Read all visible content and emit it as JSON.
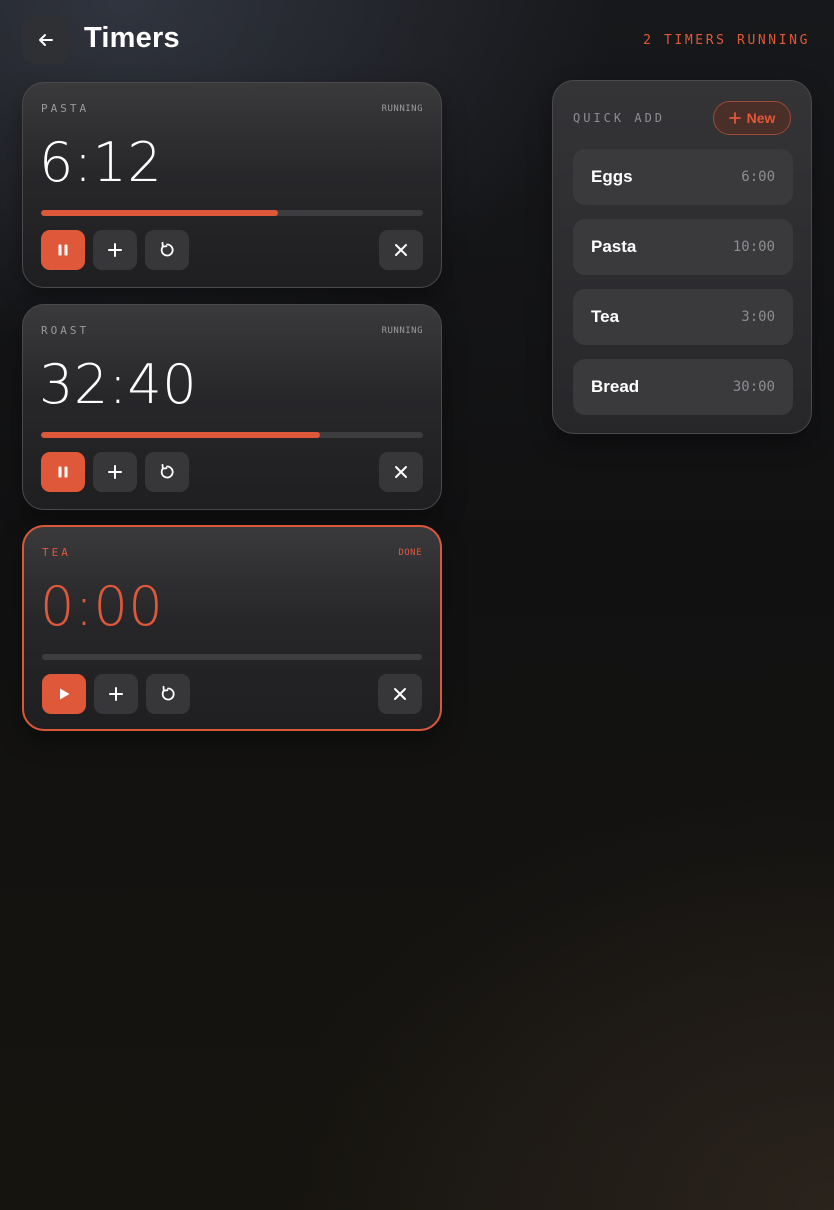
{
  "header": {
    "title": "Timers",
    "status": "2 TIMERS RUNNING",
    "back_icon": "arrow-left-icon"
  },
  "colors": {
    "accent": "#e0583a",
    "card": "#27272a",
    "button": "#37373a"
  },
  "timers": [
    {
      "label": "PASTA",
      "state": "RUNNING",
      "time": "6:12",
      "progress": 0.62,
      "primary_icon": "pause-icon",
      "done": false
    },
    {
      "label": "ROAST",
      "state": "RUNNING",
      "time": "32:40",
      "progress": 0.73,
      "primary_icon": "pause-icon",
      "done": false
    },
    {
      "label": "TEA",
      "state": "DONE",
      "time": "0:00",
      "progress": 0,
      "primary_icon": "play-icon",
      "done": true
    }
  ],
  "quick_add": {
    "title": "QUICK ADD",
    "new_label": "New",
    "presets": [
      {
        "name": "Eggs",
        "duration": "6:00"
      },
      {
        "name": "Pasta",
        "duration": "10:00"
      },
      {
        "name": "Tea",
        "duration": "3:00"
      },
      {
        "name": "Bread",
        "duration": "30:00"
      }
    ]
  }
}
